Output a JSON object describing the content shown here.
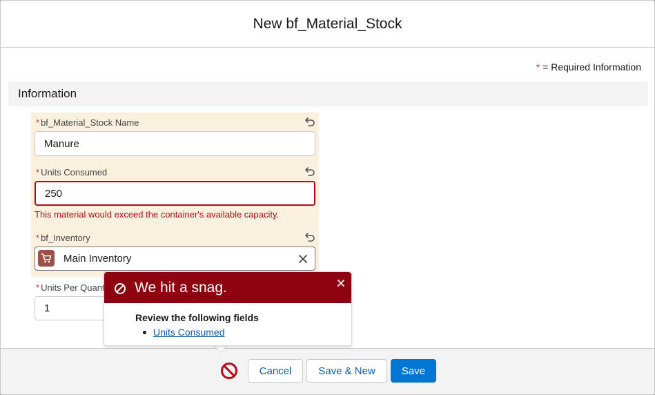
{
  "modal": {
    "title": "New bf_Material_Stock"
  },
  "required_info": {
    "star": "*",
    "text": "= Required Information"
  },
  "section": {
    "title": "Information"
  },
  "fields": [
    {
      "label": "bf_Material_Stock Name",
      "value": "Manure",
      "required": true
    },
    {
      "label": "Units Consumed",
      "value": "250",
      "required": true,
      "error": "This material would exceed the container's available capacity."
    },
    {
      "label": "bf_Inventory",
      "value": "Main Inventory",
      "required": true
    },
    {
      "label": "Units Per Quant",
      "value": "1",
      "required": true
    }
  ],
  "popover": {
    "title": "We hit a snag.",
    "body_title": "Review the following fields",
    "links": [
      "Units Consumed"
    ]
  },
  "footer": {
    "cancel_label": "Cancel",
    "save_new_label": "Save & New",
    "save_label": "Save"
  },
  "colors": {
    "error": "#ba0517",
    "popover_header": "#8e030f",
    "brand": "#0176d3",
    "highlight": "#faf0de",
    "lookup_icon": "#9e5247"
  },
  "icons": [
    "undo-icon",
    "clear-icon",
    "cart-icon",
    "ban-icon",
    "close-icon",
    "error-ban-icon"
  ]
}
